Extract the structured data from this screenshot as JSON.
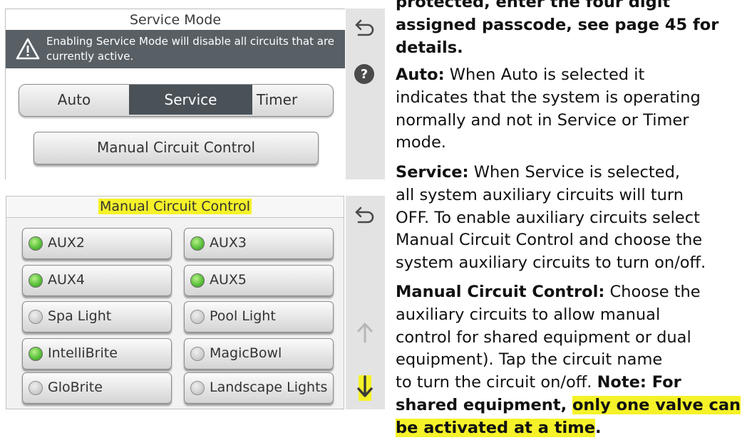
{
  "service_panel": {
    "title": "Service Mode",
    "warning": "Enabling Service Mode will disable all circuits that are currently active.",
    "modes": [
      "Auto",
      "Service",
      "Timer"
    ],
    "selected_mode": "Service",
    "manual_button": "Manual Circuit Control"
  },
  "manual_panel": {
    "title": "Manual Circuit Control",
    "circuits": [
      {
        "label": "AUX2",
        "state": "on"
      },
      {
        "label": "AUX3",
        "state": "on"
      },
      {
        "label": "AUX4",
        "state": "on"
      },
      {
        "label": "AUX5",
        "state": "on"
      },
      {
        "label": "Spa Light",
        "state": "off"
      },
      {
        "label": "Pool Light",
        "state": "off"
      },
      {
        "label": "IntelliBrite",
        "state": "on"
      },
      {
        "label": "MagicBowl",
        "state": "off"
      },
      {
        "label": "GloBrite",
        "state": "off"
      },
      {
        "label": "Landscape Lights",
        "state": "off"
      }
    ]
  },
  "icons": {
    "warning": "warning-triangle-icon",
    "back": "back-arrow-icon",
    "help": "help-icon",
    "scroll_up": "arrow-up-icon",
    "scroll_down": "arrow-down-icon"
  },
  "colors": {
    "banner": "#586066",
    "selected_segment": "#4a5258",
    "indicator_on": "#5bc23b",
    "highlight": "#f5f229"
  },
  "manual_text": {
    "intro": [
      "protected, enter the four digit",
      "assigned passcode, see page 45 for",
      "details."
    ],
    "auto_term": "Auto:",
    "auto_desc": [
      " When Auto is selected it",
      "indicates that the system is operating",
      "normally and not in Service or Timer",
      "mode."
    ],
    "service_term": "Service:",
    "service_desc": [
      " When Service is selected,",
      "all system auxiliary circuits will turn",
      "OFF. To enable auxiliary circuits select",
      "Manual Circuit Control and choose the",
      "system auxiliary circuits to turn on/off."
    ],
    "mcc_term": "Manual Circuit Control:",
    "mcc_desc": [
      " Choose the",
      "auxiliary circuits to allow manual",
      "control for shared equipment or dual",
      "equipment). Tap the circuit name",
      "to turn the circuit on/off. "
    ],
    "note_label": "Note: For",
    "note_line2a": "shared equipment, ",
    "note_line2b": "only one valve can",
    "note_line3": "be activated at a time",
    "note_end": "."
  }
}
